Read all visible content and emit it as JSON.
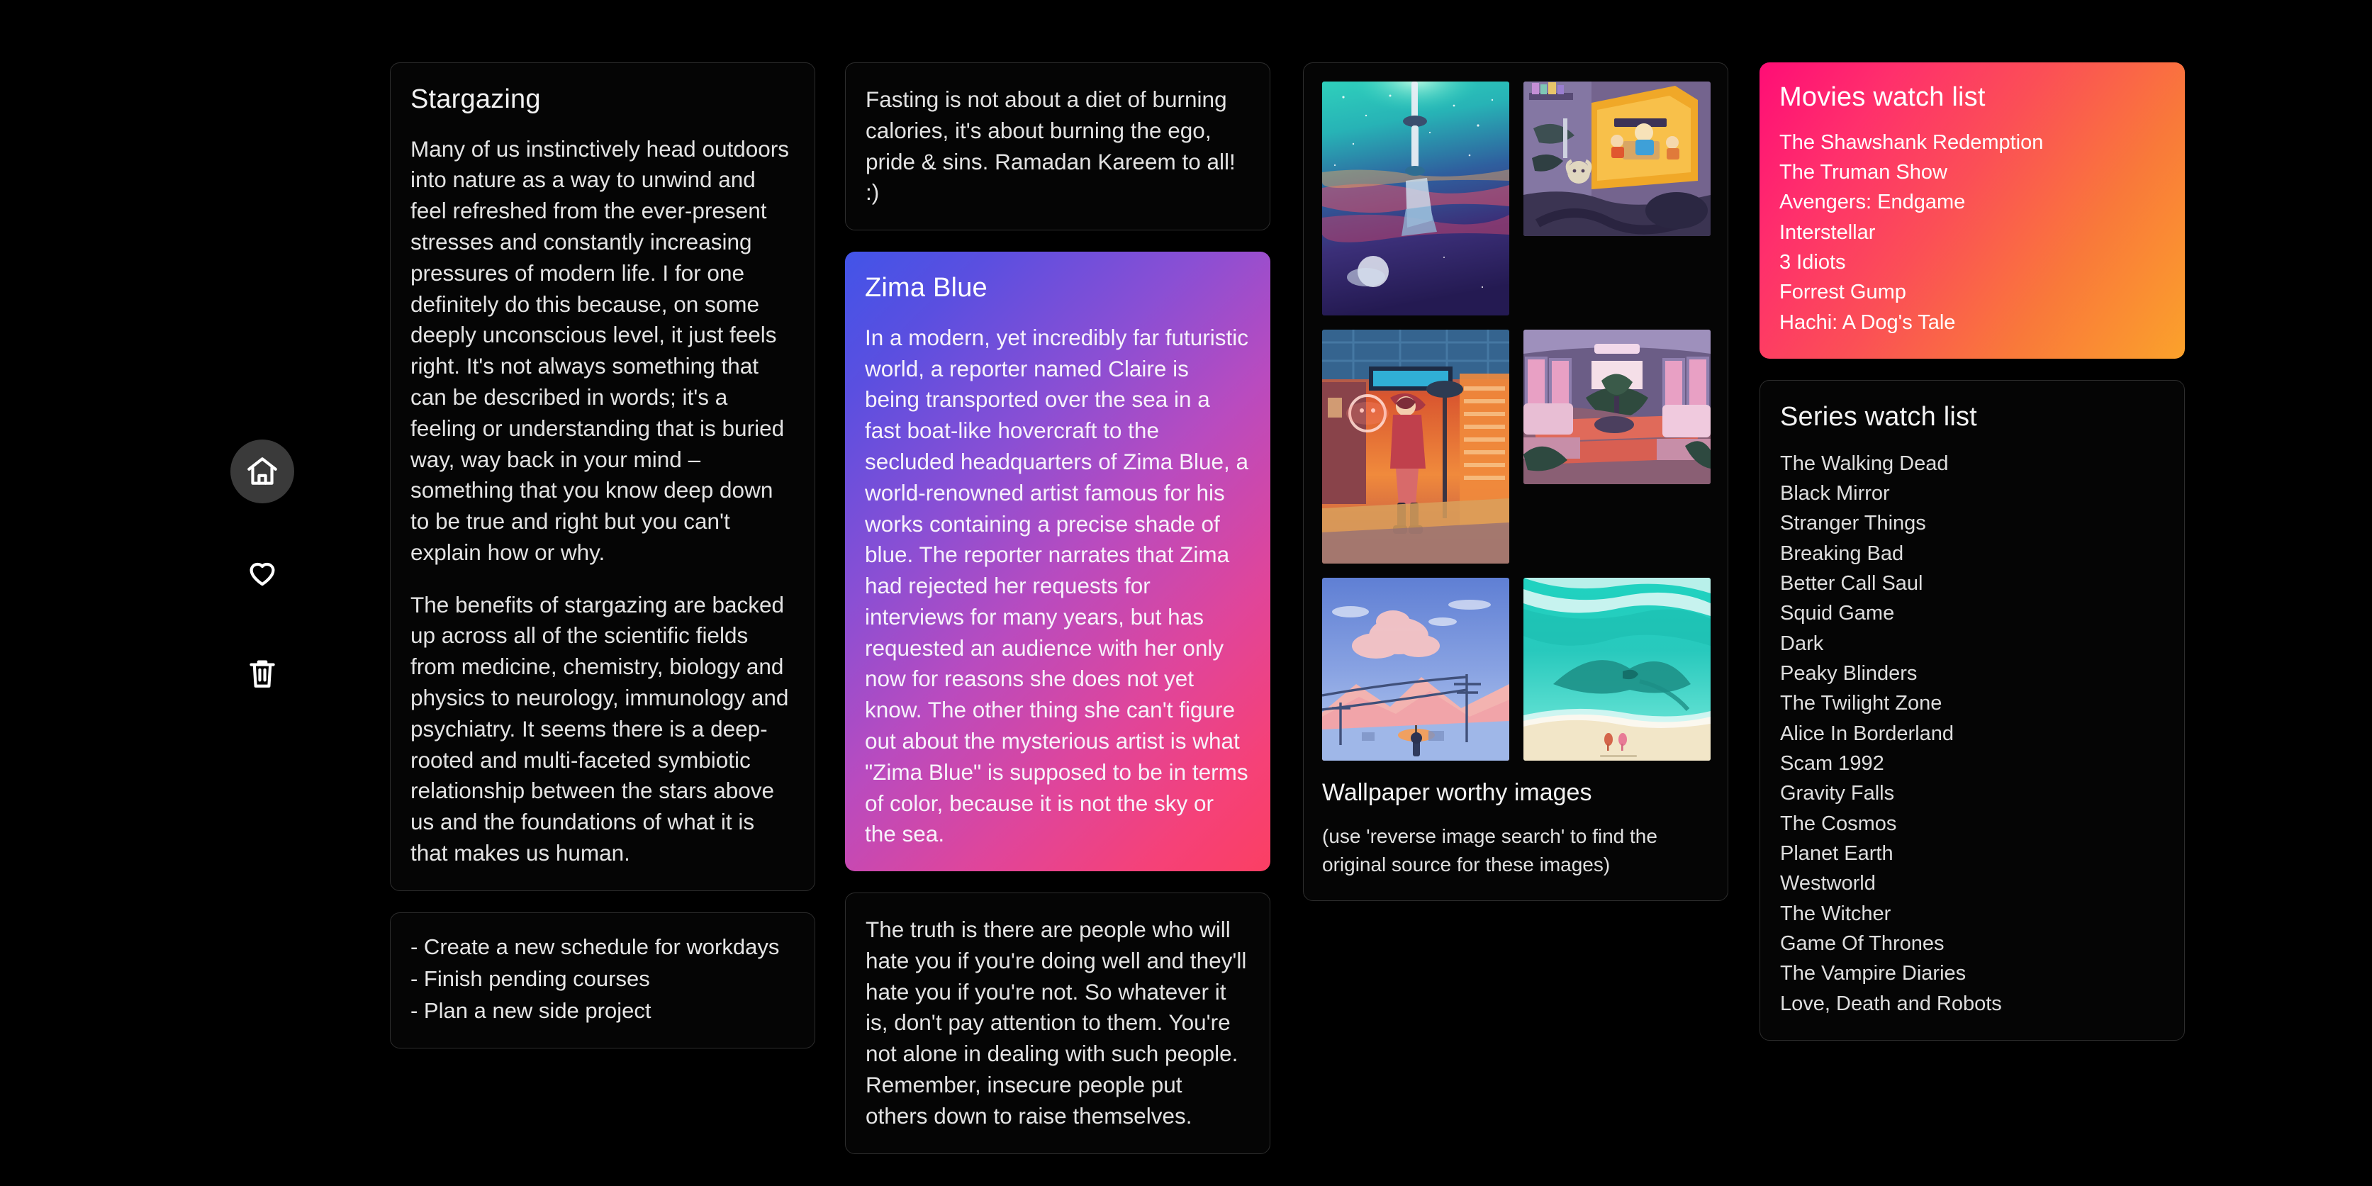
{
  "sidebar": {
    "items": [
      {
        "name": "home",
        "icon": "home-icon",
        "active": true
      },
      {
        "name": "favorites",
        "icon": "heart-icon",
        "active": false
      },
      {
        "name": "trash",
        "icon": "trash-icon",
        "active": false
      }
    ]
  },
  "cards": {
    "stargazing": {
      "title": "Stargazing",
      "paragraph1": "Many of us instinctively head outdoors into nature as a way to unwind and feel refreshed from the ever-present stresses and constantly increasing pressures of modern life. I for one definitely do this because, on some deeply unconscious level, it just feels right. It's not always something that can be described in words; it's a feeling or understanding that is buried way, way back in your mind – something that you know deep down to be true and right but you can't explain how or why.",
      "paragraph2": "The benefits of stargazing are backed up across all of the scientific fields from medicine, chemistry, biology and physics to neurology, immunology and psychiatry. It seems there is a deep-rooted and multi-faceted symbiotic relationship between the stars above us and the foundations of what it is that makes us human."
    },
    "todo": {
      "items": [
        "- Create a new schedule for workdays",
        "- Finish pending courses",
        "- Plan a new side project"
      ]
    },
    "fasting": {
      "text": "Fasting is not about a diet of burning calories, it's about burning the ego, pride & sins. Ramadan Kareem to all! :)"
    },
    "zima": {
      "title": "Zima Blue",
      "text": "In a modern, yet incredibly far futuristic world, a reporter named Claire is being transported over the sea in a fast boat-like hovercraft to the secluded headquarters of Zima Blue, a world-renowned artist famous for his works containing a precise shade of blue. The reporter narrates that Zima had rejected her requests for interviews for many years, but has requested an audience with her only now for reasons she does not yet know. The other thing she can't figure out about the mysterious artist is what \"Zima Blue\" is supposed to be in terms of color, because it is not the sky or the sea.",
      "gradient_from": "#4254e8",
      "gradient_to": "#fb3f63"
    },
    "haters": {
      "text": "The truth is there are people who will hate you if you're doing well and they'll hate you if you're not. So whatever it is, don't pay attention to them. You're not alone in dealing with such people. Remember, insecure people put others down to raise themselves."
    },
    "gallery": {
      "title": "Wallpaper worthy images",
      "note": "(use 'reverse image search' to find the original source for these images)",
      "images": [
        {
          "name": "underwater-figure-art",
          "alt": "Teal underwater scene with falling figure"
        },
        {
          "name": "cozy-attic-room-art",
          "alt": "Purple attic room with characters"
        },
        {
          "name": "neon-street-girl-art",
          "alt": "Red neon city street with girl"
        },
        {
          "name": "train-interior-art",
          "alt": "Overgrown train carriage interior"
        },
        {
          "name": "pink-clouds-mountain-art",
          "alt": "Pink clouds over snowy mountain with umbrella"
        },
        {
          "name": "ocean-manta-ray-art",
          "alt": "Giant manta ray in turquoise ocean near beach"
        }
      ]
    },
    "movies": {
      "title": "Movies watch list",
      "items": [
        "The Shawshank Redemption",
        "The Truman Show",
        "Avengers: Endgame",
        "Interstellar",
        "3 Idiots",
        "Forrest Gump",
        "Hachi: A Dog's Tale"
      ],
      "gradient_from": "#ff0d76",
      "gradient_to": "#fba22b"
    },
    "series": {
      "title": "Series watch list",
      "items": [
        "The Walking Dead",
        "Black Mirror",
        "Stranger Things",
        "Breaking Bad",
        "Better Call Saul",
        "Squid Game",
        "Dark",
        "Peaky Blinders",
        "The Twilight Zone",
        "Alice In Borderland",
        "Scam 1992",
        "Gravity Falls",
        "The Cosmos",
        "Planet Earth",
        "Westworld",
        "The Witcher",
        "Game Of Thrones",
        "The Vampire Diaries",
        "Love, Death and Robots"
      ]
    }
  },
  "colors": {
    "background": "#000000",
    "card_background": "#050505",
    "card_border": "#2d2d2d",
    "text_primary": "#f2f2f2",
    "text_secondary": "#e3e3e3",
    "nav_active_background": "#3a3a3a"
  }
}
